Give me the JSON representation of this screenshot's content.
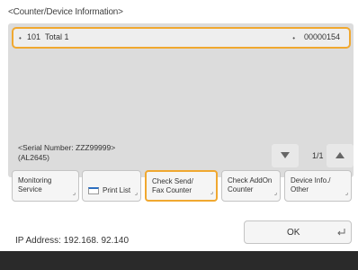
{
  "header": {
    "title": "<Counter/Device Information>"
  },
  "counter_list": {
    "items": [
      {
        "number": "101",
        "name": "Total 1",
        "value": "00000154"
      }
    ]
  },
  "device": {
    "serial_line1": "<Serial Number: ZZZ99999>",
    "serial_line2": "(AL2645)"
  },
  "pager": {
    "text": "1/1"
  },
  "tabs": [
    {
      "line1": "Monitoring",
      "line2": "Service"
    },
    {
      "line1": "Print List",
      "line2": ""
    },
    {
      "line1": "Check Send/",
      "line2": "Fax Counter"
    },
    {
      "line1": "Check AddOn",
      "line2": "Counter"
    },
    {
      "line1": "Device Info./",
      "line2": "Other"
    }
  ],
  "footer": {
    "ip_address": "IP Address: 192.168. 92.140",
    "ok_label": "OK"
  },
  "colors": {
    "highlight": "#f0a830",
    "bottom_bar": "#2a2a2a"
  }
}
